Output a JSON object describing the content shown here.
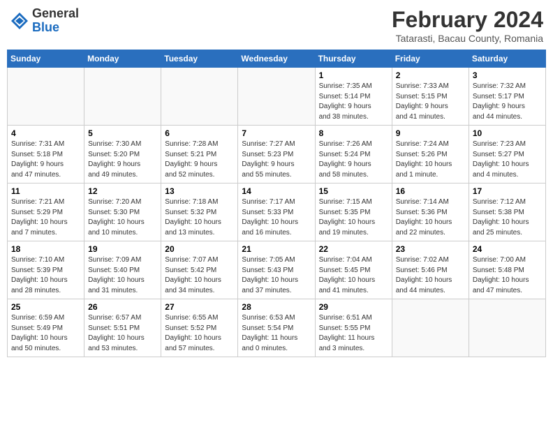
{
  "logo": {
    "general": "General",
    "blue": "Blue"
  },
  "title": "February 2024",
  "subtitle": "Tatarasti, Bacau County, Romania",
  "weekdays": [
    "Sunday",
    "Monday",
    "Tuesday",
    "Wednesday",
    "Thursday",
    "Friday",
    "Saturday"
  ],
  "weeks": [
    [
      {
        "date": "",
        "info": ""
      },
      {
        "date": "",
        "info": ""
      },
      {
        "date": "",
        "info": ""
      },
      {
        "date": "",
        "info": ""
      },
      {
        "date": "1",
        "info": "Sunrise: 7:35 AM\nSunset: 5:14 PM\nDaylight: 9 hours\nand 38 minutes."
      },
      {
        "date": "2",
        "info": "Sunrise: 7:33 AM\nSunset: 5:15 PM\nDaylight: 9 hours\nand 41 minutes."
      },
      {
        "date": "3",
        "info": "Sunrise: 7:32 AM\nSunset: 5:17 PM\nDaylight: 9 hours\nand 44 minutes."
      }
    ],
    [
      {
        "date": "4",
        "info": "Sunrise: 7:31 AM\nSunset: 5:18 PM\nDaylight: 9 hours\nand 47 minutes."
      },
      {
        "date": "5",
        "info": "Sunrise: 7:30 AM\nSunset: 5:20 PM\nDaylight: 9 hours\nand 49 minutes."
      },
      {
        "date": "6",
        "info": "Sunrise: 7:28 AM\nSunset: 5:21 PM\nDaylight: 9 hours\nand 52 minutes."
      },
      {
        "date": "7",
        "info": "Sunrise: 7:27 AM\nSunset: 5:23 PM\nDaylight: 9 hours\nand 55 minutes."
      },
      {
        "date": "8",
        "info": "Sunrise: 7:26 AM\nSunset: 5:24 PM\nDaylight: 9 hours\nand 58 minutes."
      },
      {
        "date": "9",
        "info": "Sunrise: 7:24 AM\nSunset: 5:26 PM\nDaylight: 10 hours\nand 1 minute."
      },
      {
        "date": "10",
        "info": "Sunrise: 7:23 AM\nSunset: 5:27 PM\nDaylight: 10 hours\nand 4 minutes."
      }
    ],
    [
      {
        "date": "11",
        "info": "Sunrise: 7:21 AM\nSunset: 5:29 PM\nDaylight: 10 hours\nand 7 minutes."
      },
      {
        "date": "12",
        "info": "Sunrise: 7:20 AM\nSunset: 5:30 PM\nDaylight: 10 hours\nand 10 minutes."
      },
      {
        "date": "13",
        "info": "Sunrise: 7:18 AM\nSunset: 5:32 PM\nDaylight: 10 hours\nand 13 minutes."
      },
      {
        "date": "14",
        "info": "Sunrise: 7:17 AM\nSunset: 5:33 PM\nDaylight: 10 hours\nand 16 minutes."
      },
      {
        "date": "15",
        "info": "Sunrise: 7:15 AM\nSunset: 5:35 PM\nDaylight: 10 hours\nand 19 minutes."
      },
      {
        "date": "16",
        "info": "Sunrise: 7:14 AM\nSunset: 5:36 PM\nDaylight: 10 hours\nand 22 minutes."
      },
      {
        "date": "17",
        "info": "Sunrise: 7:12 AM\nSunset: 5:38 PM\nDaylight: 10 hours\nand 25 minutes."
      }
    ],
    [
      {
        "date": "18",
        "info": "Sunrise: 7:10 AM\nSunset: 5:39 PM\nDaylight: 10 hours\nand 28 minutes."
      },
      {
        "date": "19",
        "info": "Sunrise: 7:09 AM\nSunset: 5:40 PM\nDaylight: 10 hours\nand 31 minutes."
      },
      {
        "date": "20",
        "info": "Sunrise: 7:07 AM\nSunset: 5:42 PM\nDaylight: 10 hours\nand 34 minutes."
      },
      {
        "date": "21",
        "info": "Sunrise: 7:05 AM\nSunset: 5:43 PM\nDaylight: 10 hours\nand 37 minutes."
      },
      {
        "date": "22",
        "info": "Sunrise: 7:04 AM\nSunset: 5:45 PM\nDaylight: 10 hours\nand 41 minutes."
      },
      {
        "date": "23",
        "info": "Sunrise: 7:02 AM\nSunset: 5:46 PM\nDaylight: 10 hours\nand 44 minutes."
      },
      {
        "date": "24",
        "info": "Sunrise: 7:00 AM\nSunset: 5:48 PM\nDaylight: 10 hours\nand 47 minutes."
      }
    ],
    [
      {
        "date": "25",
        "info": "Sunrise: 6:59 AM\nSunset: 5:49 PM\nDaylight: 10 hours\nand 50 minutes."
      },
      {
        "date": "26",
        "info": "Sunrise: 6:57 AM\nSunset: 5:51 PM\nDaylight: 10 hours\nand 53 minutes."
      },
      {
        "date": "27",
        "info": "Sunrise: 6:55 AM\nSunset: 5:52 PM\nDaylight: 10 hours\nand 57 minutes."
      },
      {
        "date": "28",
        "info": "Sunrise: 6:53 AM\nSunset: 5:54 PM\nDaylight: 11 hours\nand 0 minutes."
      },
      {
        "date": "29",
        "info": "Sunrise: 6:51 AM\nSunset: 5:55 PM\nDaylight: 11 hours\nand 3 minutes."
      },
      {
        "date": "",
        "info": ""
      },
      {
        "date": "",
        "info": ""
      }
    ]
  ]
}
